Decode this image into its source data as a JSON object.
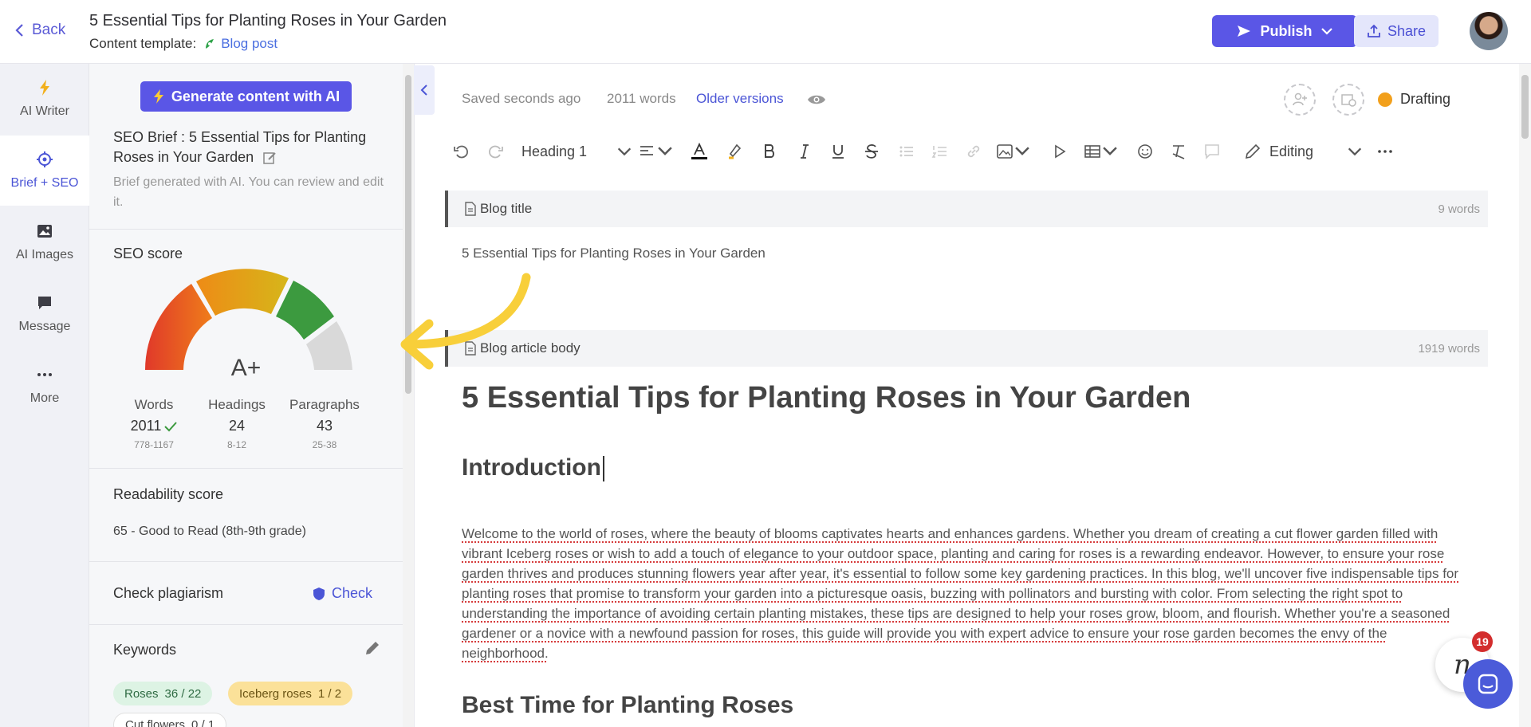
{
  "header": {
    "back_label": "Back",
    "title": "5 Essential Tips for Planting Roses in Your Garden",
    "template_label": "Content template:",
    "template_value": "Blog post",
    "publish_label": "Publish",
    "share_label": "Share"
  },
  "rail": {
    "items": [
      {
        "label": "AI Writer",
        "icon": "lightning-icon"
      },
      {
        "label": "Brief + SEO",
        "icon": "target-icon",
        "active": true
      },
      {
        "label": "AI Images",
        "icon": "image-icon"
      },
      {
        "label": "Message",
        "icon": "chat-icon"
      },
      {
        "label": "More",
        "icon": "more-icon"
      }
    ]
  },
  "panel": {
    "generate_label": "Generate content with AI",
    "brief_title": "SEO Brief : 5 Essential Tips for Planting Roses in Your Garden",
    "brief_sub": "Brief generated with AI. You can review and edit it.",
    "seo_label": "SEO score",
    "grade": "A+",
    "stats": [
      {
        "label": "Words",
        "value": "2011",
        "range": "778-1167"
      },
      {
        "label": "Headings",
        "value": "24",
        "range": "8-12"
      },
      {
        "label": "Paragraphs",
        "value": "43",
        "range": "25-38"
      }
    ],
    "readability_label": "Readability score",
    "readability_value": "65 - Good to Read (8th-9th grade)",
    "plagiarism_label": "Check plagiarism",
    "check_label": "Check",
    "keywords_label": "Keywords",
    "keywords": [
      {
        "name": "Roses",
        "count": "36 / 22"
      },
      {
        "name": "Iceberg roses",
        "count": "1 / 2"
      },
      {
        "name": "Cut flowers",
        "count": "0 / 1"
      }
    ]
  },
  "editor": {
    "saved": "Saved seconds ago",
    "word_count": "2011 words",
    "older_versions": "Older versions",
    "status": "Drafting",
    "heading_select": "Heading 1",
    "mode_select": "Editing",
    "title_block": {
      "label": "Blog title",
      "words": "9 words",
      "value": "5 Essential Tips for Planting Roses in Your Garden"
    },
    "body_block": {
      "label": "Blog article body",
      "words": "1919 words"
    },
    "h1": "5 Essential Tips for Planting Roses in Your Garden",
    "h2_intro": "Introduction",
    "paragraph": "Welcome to the world of roses, where the beauty of blooms captivates hearts and enhances gardens. Whether you dream of creating a cut flower garden filled with vibrant Iceberg roses or wish to add a touch of elegance to your outdoor space, planting and caring for roses is a rewarding endeavor. However, to ensure your rose garden thrives and produces stunning flowers year after year, it's essential to follow some key gardening practices. In this blog, we'll uncover five indispensable tips for planting roses that promise to transform your garden into a picturesque oasis, buzzing with pollinators and bursting with color. From selecting the right spot to understanding the importance of avoiding certain planting mistakes, these tips are designed to help your roses grow, bloom, and flourish. Whether you're a seasoned gardener or a novice with a newfound passion for roses, this guide will provide you with expert advice to ensure your rose garden becomes the envy of the neighborhood.",
    "h2_best_time": "Best Time for Planting Roses"
  },
  "notifications": {
    "count": "19"
  },
  "colors": {
    "accent": "#5a56e6",
    "drafting": "#f2a01c",
    "gauge_red": "#e0392a",
    "gauge_yellow": "#e9b10f",
    "gauge_green": "#3c9a3f"
  }
}
